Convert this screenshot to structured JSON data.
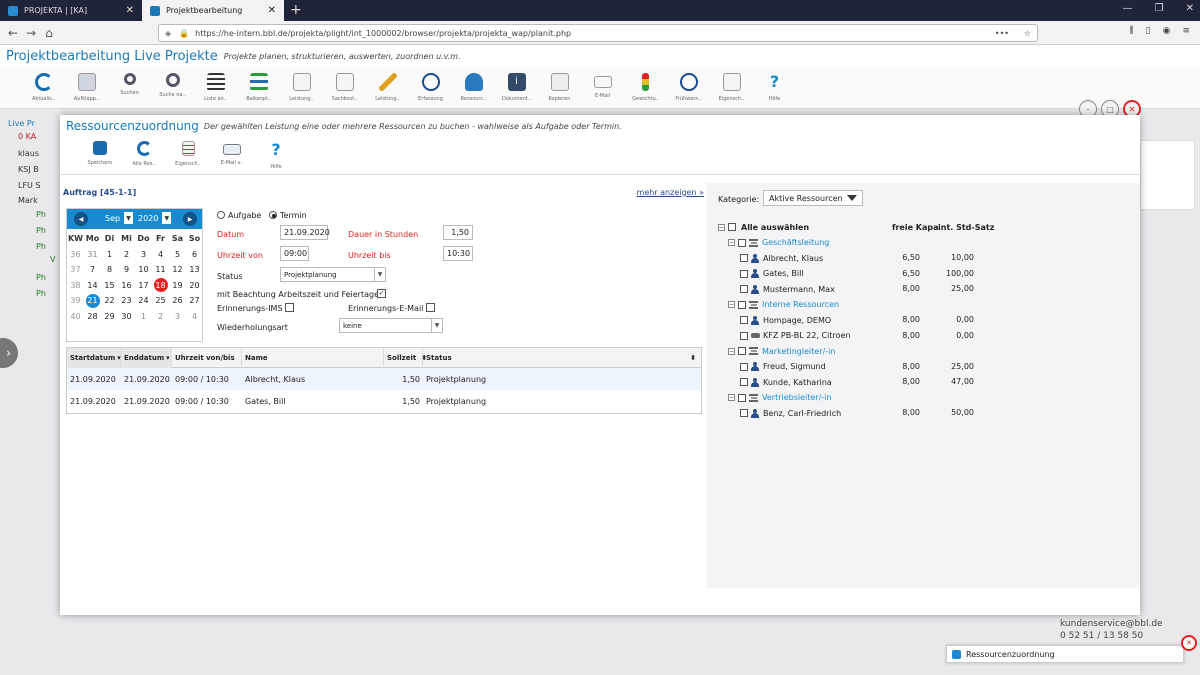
{
  "browser": {
    "tabs": [
      {
        "label": "PROJEKTA | [KA]"
      },
      {
        "label": "Projektbearbeitung"
      }
    ],
    "url": "https://he-intern.bbl.de/projekta/plight/int_1000002/browser/projekta/projekta_wap/planit.php"
  },
  "app": {
    "title": "Projektbearbeitung Live Projekte",
    "subtitle": "Projekte planen, strukturieren, auswerten, zuordnen u.v.m.",
    "toolbar": [
      "Aktualis..",
      "Aufklapp..",
      "Suchen",
      "Suche na..",
      "Liste an..",
      "Balkenpl..",
      "Leistung..",
      "Sachkost..",
      "Leistung..",
      "Erfassung",
      "Ressourc..",
      "Dokument..",
      "Kopieren",
      "E-Mail",
      "Gewichtu..",
      "Frühwarn..",
      "Eigensch..",
      "Hilfe"
    ],
    "tree": [
      "Live Pr",
      "0 KA",
      "klaus",
      "KSJ B",
      "LFU S",
      "Mark",
      "Ph",
      "Ph",
      "Ph",
      "V",
      "Ph",
      "Ph"
    ]
  },
  "background": {
    "footer_email": "kundenservice@bbl.de",
    "footer_phone": "0 52 51 / 13 58 50"
  },
  "dialog": {
    "title": "Ressourcenzuordnung",
    "subtitle": "Der gewählten Leistung eine oder mehrere Ressourcen zu buchen - wahlweise als Aufgabe oder Termin.",
    "toolbar": [
      "Speichern",
      "Alle Res..",
      "Eigensch..",
      "E-Mail v..",
      "Hilfe"
    ],
    "auftrag": "Auftrag [45-1-1]",
    "mehr": "mehr anzeigen",
    "calendar": {
      "month": "Sep",
      "year": "2020",
      "headers": [
        "KW",
        "Mo",
        "Di",
        "Mi",
        "Do",
        "Fr",
        "Sa",
        "So"
      ],
      "weeks": [
        [
          "36",
          "31",
          "1",
          "2",
          "3",
          "4",
          "5",
          "6"
        ],
        [
          "37",
          "7",
          "8",
          "9",
          "10",
          "11",
          "12",
          "13"
        ],
        [
          "38",
          "14",
          "15",
          "16",
          "17",
          "18",
          "19",
          "20"
        ],
        [
          "39",
          "21",
          "22",
          "23",
          "24",
          "25",
          "26",
          "27"
        ],
        [
          "40",
          "28",
          "29",
          "30",
          "1",
          "2",
          "3",
          "4"
        ]
      ],
      "today": "18",
      "selected": "21"
    },
    "form": {
      "radio_aufgabe": "Aufgabe",
      "radio_termin": "Termin",
      "datum_label": "Datum",
      "datum_value": "21.09.2020",
      "dauer_label": "Dauer in Stunden",
      "dauer_value": "1,50",
      "von_label": "Uhrzeit von",
      "von_value": "09:00",
      "bis_label": "Uhrzeit bis",
      "bis_value": "10:30",
      "status_label": "Status",
      "status_value": "Projektplanung",
      "arbeitszeit_label": "mit Beachtung Arbeitszeit und Feiertage",
      "ims_label": "Erinnerungs-IMS",
      "email_label": "Erinnerungs-E-Mail",
      "wiederholung_label": "Wiederholungsart",
      "wiederholung_value": "keine"
    },
    "table": {
      "columns": [
        "Startdatum",
        "Enddatum",
        "Uhrzeit von/bis",
        "Name",
        "Sollzeit",
        "Status"
      ],
      "rows": [
        [
          "21.09.2020",
          "21.09.2020",
          "09:00 / 10:30",
          "Albrecht, Klaus",
          "1,50",
          "Projektplanung"
        ],
        [
          "21.09.2020",
          "21.09.2020",
          "09:00 / 10:30",
          "Gates, Bill",
          "1,50",
          "Projektplanung"
        ]
      ]
    },
    "resources": {
      "kategorie_label": "Kategorie:",
      "kategorie_value": "Aktive Ressourcen",
      "select_all": "Alle auswählen",
      "col_frei": "freie Kapa",
      "col_satz": "int. Std-Satz",
      "groups": [
        {
          "name": "Geschäftsleitung",
          "items": [
            {
              "name": "Albrecht, Klaus",
              "frei": "6,50",
              "satz": "10,00"
            },
            {
              "name": "Gates, Bill",
              "frei": "6,50",
              "satz": "100,00"
            },
            {
              "name": "Mustermann, Max",
              "frei": "8,00",
              "satz": "25,00"
            }
          ]
        },
        {
          "name": "Interne Ressourcen",
          "items": [
            {
              "name": "Hompage, DEMO",
              "frei": "8,00",
              "satz": "0,00"
            },
            {
              "name": "KFZ PB-BL 22, Citroen",
              "frei": "8,00",
              "satz": "0,00"
            }
          ]
        },
        {
          "name": "Marketingleiter/-in",
          "items": [
            {
              "name": "Freud, Sigmund",
              "frei": "8,00",
              "satz": "25,00"
            },
            {
              "name": "Kunde, Katharina",
              "frei": "8,00",
              "satz": "47,00"
            }
          ]
        },
        {
          "name": "Vertriebsleiter/-in",
          "items": [
            {
              "name": "Benz, Carl-Friedrich",
              "frei": "8,00",
              "satz": "50,00"
            }
          ]
        }
      ]
    }
  },
  "taskbar": {
    "label": "Ressourcenzuordnung"
  }
}
